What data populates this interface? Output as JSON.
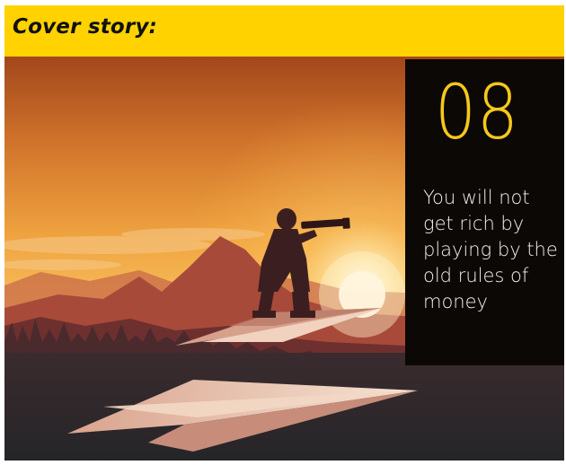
{
  "header": {
    "title": "Cover story:"
  },
  "badge": {
    "number": "08",
    "text": "You will not get rich by playing by the old rules of money"
  },
  "colors": {
    "header_bg": "#ffd200",
    "badge_bg": "#0b0805",
    "badge_number": "#f6c81a",
    "badge_text": "#f4f1ec"
  },
  "illustration": {
    "subject": "man-with-telescope-on-paper-plane",
    "icons": [
      "telescope-icon",
      "paper-plane-icon",
      "sun-icon"
    ]
  }
}
